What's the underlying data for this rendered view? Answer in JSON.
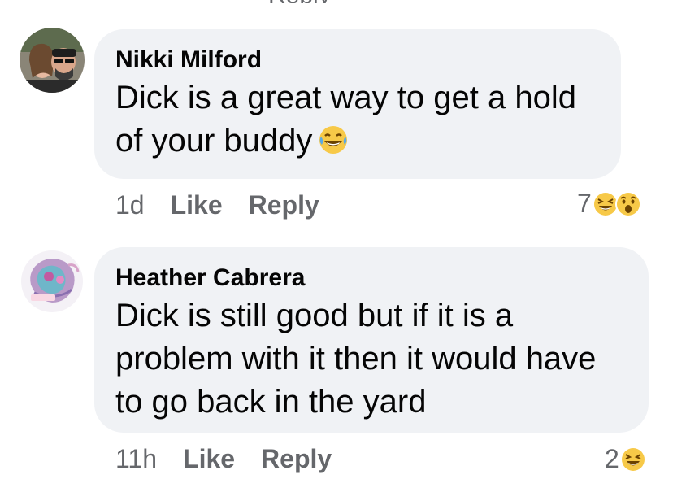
{
  "comments": [
    {
      "author": "Nikki Milford",
      "text": "Dick is a great way to get a hold of your buddy",
      "inline_emoji": "laughing-tears-emoji",
      "time": "1d",
      "like_label": "Like",
      "reply_label": "Reply",
      "reaction_count": "7",
      "reaction_icons": [
        "haha-reaction-icon",
        "wow-reaction-icon"
      ]
    },
    {
      "author": "Heather Cabrera",
      "text": "Dick is still good but if it is a problem with it then it would have to go back in the yard",
      "time": "11h",
      "like_label": "Like",
      "reply_label": "Reply",
      "reaction_count": "2",
      "reaction_icons": [
        "haha-reaction-icon"
      ]
    }
  ],
  "colors": {
    "bubble": "#f0f2f5",
    "text": "#050505",
    "meta": "#65676b",
    "reaction_yellow": "#f7c948"
  }
}
